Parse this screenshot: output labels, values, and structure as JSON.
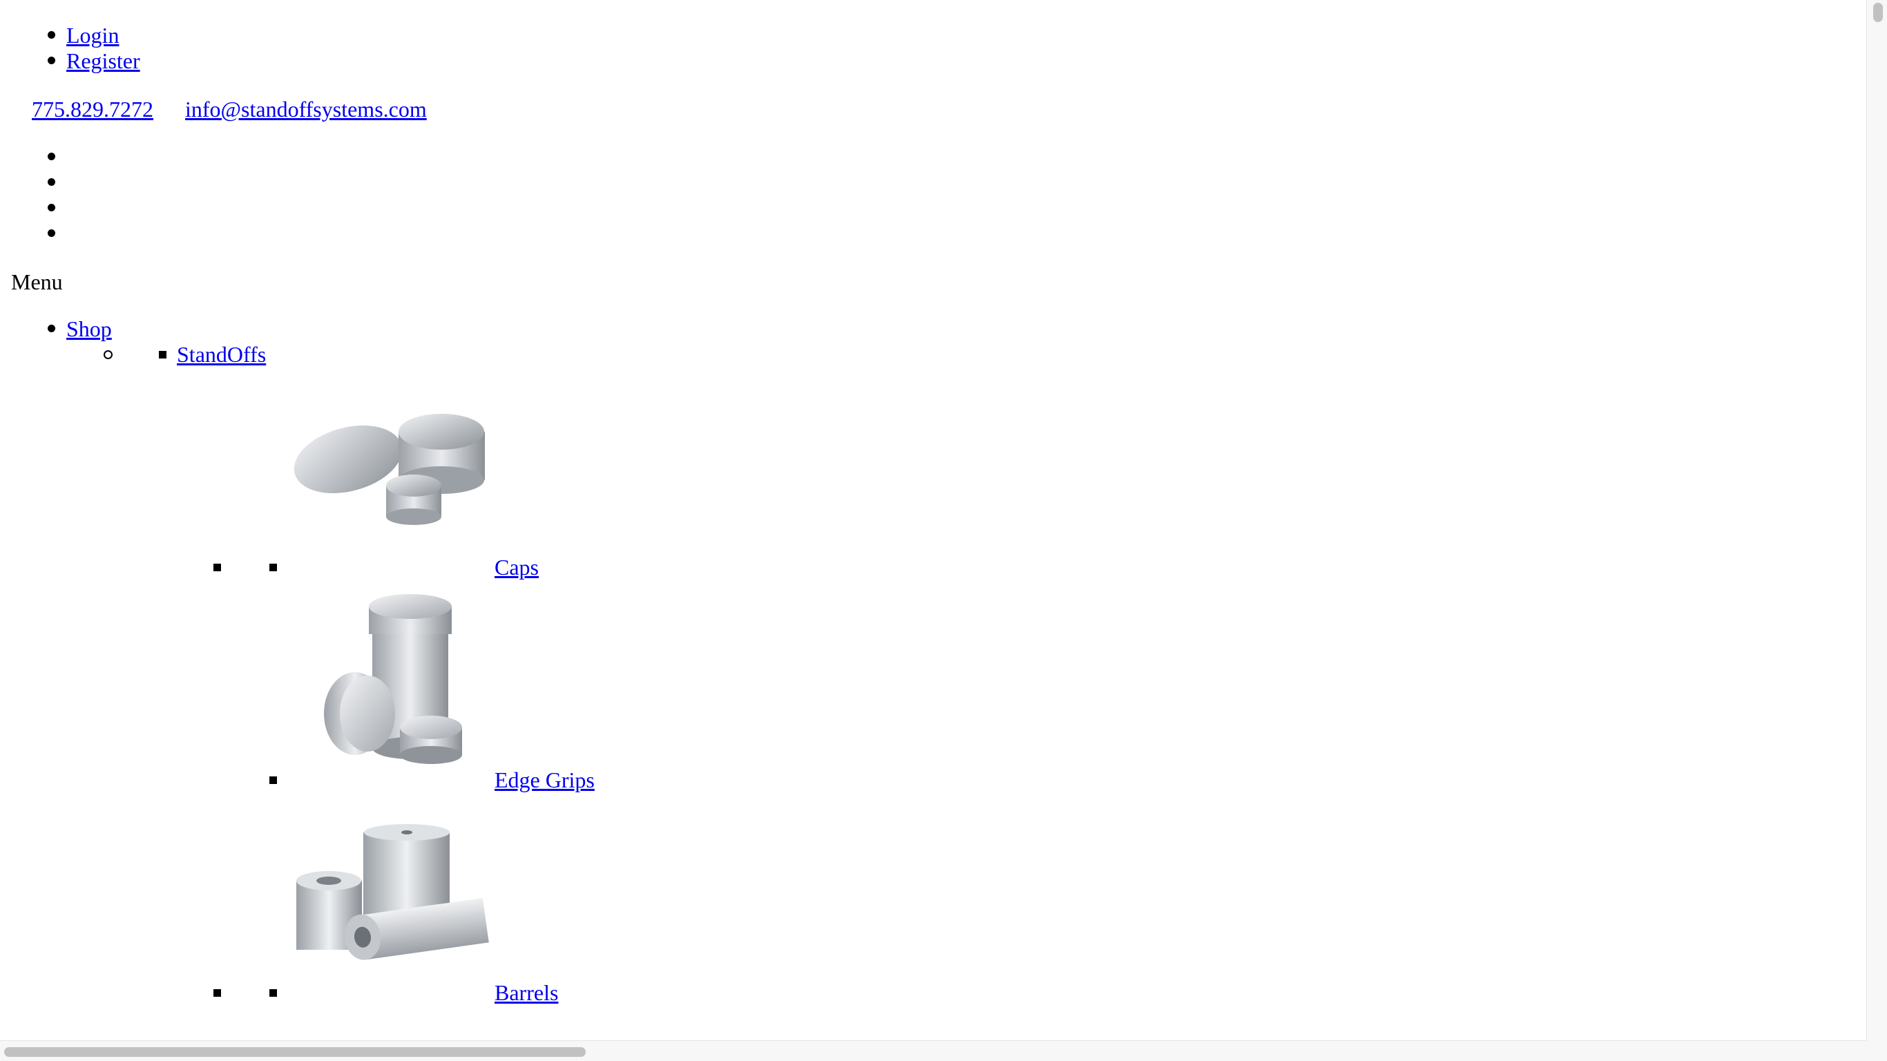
{
  "account_links": [
    {
      "label": "Login"
    },
    {
      "label": "Register"
    }
  ],
  "contact": {
    "phone": "775.829.7272",
    "email": "info@standoffsystems.com"
  },
  "social_icons": [
    "social-icon-1",
    "social-icon-2",
    "social-icon-3",
    "social-icon-4"
  ],
  "menu": {
    "title": "Menu",
    "top_item": "Shop",
    "category": "StandOffs",
    "products": [
      {
        "label": "Caps",
        "icon": "caps-product-image"
      },
      {
        "label": "Edge Grips",
        "icon": "edge-grips-product-image"
      },
      {
        "label": "Barrels",
        "icon": "barrels-product-image"
      }
    ]
  },
  "colors": {
    "link": "#0000ee",
    "text": "#000000",
    "background": "#ffffff",
    "metal": "#c9ccd0"
  }
}
